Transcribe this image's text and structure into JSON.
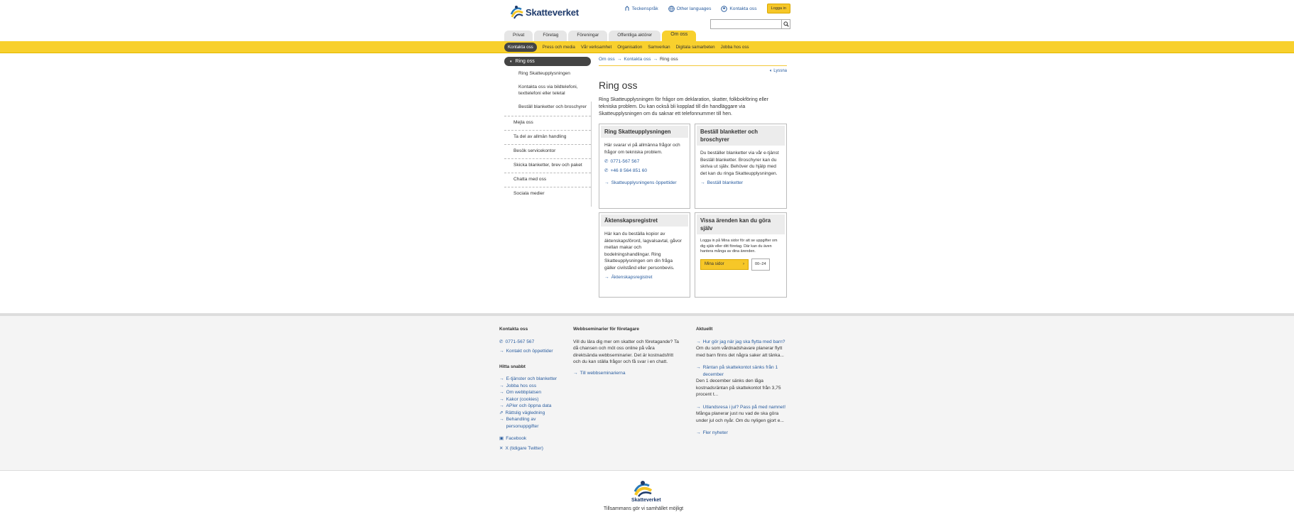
{
  "header": {
    "logo_text": "Skatteverket",
    "top_links": [
      {
        "label": "Teckenspråk",
        "icon": "sign-language-icon"
      },
      {
        "label": "Other languages",
        "icon": "globe-icon"
      },
      {
        "label": "Kontakta oss",
        "icon": "contact-icon"
      }
    ],
    "login_label": "Logga in",
    "search_placeholder": ""
  },
  "tabs": [
    {
      "label": "Privat"
    },
    {
      "label": "Företag"
    },
    {
      "label": "Föreningar"
    },
    {
      "label": "Offentliga aktörer"
    },
    {
      "label": "Om oss"
    }
  ],
  "subnav": [
    {
      "label": "Kontakta oss"
    },
    {
      "label": "Press och media"
    },
    {
      "label": "Vår verksamhet"
    },
    {
      "label": "Organisation"
    },
    {
      "label": "Samverkan"
    },
    {
      "label": "Digitala samarbeten"
    },
    {
      "label": "Jobba hos oss"
    }
  ],
  "leftnav": {
    "current": "Ring oss",
    "subitems": [
      "Ring Skatteupplysningen",
      "Kontakta oss via bildtelefoni, texttelefoni eller teletal",
      "Beställ blanketter och broschyrer"
    ],
    "items": [
      "Mejla oss",
      "Ta del av allmän handling",
      "Besök servicekontor",
      "Skicka blanketter, brev och paket",
      "Chatta med oss",
      "Sociala medier"
    ]
  },
  "main": {
    "breadcrumb": [
      "Om oss",
      "Kontakta oss",
      "Ring oss"
    ],
    "listen_label": "Lyssna",
    "title": "Ring oss",
    "intro": "Ring Skatteupplysningen för frågor om deklaration, skatter, folkbokföring eller tekniska problem. Du kan också bli kopplad till din handläggare via Skatteupplysningen om du saknar ett telefonnummer till hen.",
    "cards": {
      "ring": {
        "title": "Ring Skatteupplysningen",
        "text": "Här svarar vi på allmänna frågor och frågor om tekniska problem.",
        "phone1": "0771-567 567",
        "phone2": "+46 8 564 851 60",
        "link": "Skatteupplysningens öppettider"
      },
      "bestall": {
        "title": "Beställ blanketter och broschyrer",
        "text": "Du beställer blanketter via vår e-tjänst Beställ blanketter. Broschyrer kan du skriva ut själv. Behöver du hjälp med det kan du ringa Skatteupplysningen.",
        "link": "Beställ blanketter"
      },
      "akt": {
        "title": "Äktenskapsregistret",
        "text": "Här kan du beställa kopior av äktenskapsförord, lagvalsavtal, gåvor mellan makar och bodelningshandlingar. Ring Skatteupplysningen om din fråga gäller civilstånd eller personbevis.",
        "link": "Äktenskapsregistret"
      },
      "sjalv": {
        "title": "Vissa ärenden kan du göra själv",
        "text": "Logga in på Mina sidor för att se uppgifter om dig själv eller ditt företag. Där kan du även hantera många av dina ärenden.",
        "button": "Mina sidor",
        "hours": "00–24"
      }
    }
  },
  "footer": {
    "contact": {
      "heading": "Kontakta oss",
      "phone": "0771-567 567",
      "link": "Kontakt och öppettider"
    },
    "quick": {
      "heading": "Hitta snabbt",
      "links": [
        "E-tjänster och blanketter",
        "Jobba hos oss",
        "Om webbplatsen",
        "Kakor (cookies)",
        "APIer och öppna data",
        "Rättslig vägledning",
        "Behandling av personuppgifter"
      ]
    },
    "social": [
      "Facebook",
      "X (tidigare Twitter)"
    ],
    "webinars": {
      "heading": "Webbseminarier för företagare",
      "text": "Vill du lära dig mer om skatter och företagande? Ta då chansen och möt oss online på våra direktsända webbseminarier. Det är kostnadsfritt och du kan ställa frågor och få svar i en chatt.",
      "link": "Till webbseminarierna"
    },
    "news": {
      "heading": "Aktuellt",
      "items": [
        {
          "title": "Hur gör jag när jag ska flytta med barn?",
          "desc": "Om du som vårdnadshavare planerar flytt med barn finns det några saker att tänka..."
        },
        {
          "title": "Räntan på skattekontot sänks från 1 december",
          "desc": "Den 1 december sänks den låga kostnadsräntan på skattekontot från 3,75 procent t..."
        },
        {
          "title": "Utlandsresa i jul? Pass på med namnet!",
          "desc": "Många planerar just nu vad de ska göra under jul och nyår. Om du nyligen gjort e..."
        }
      ],
      "more": "Fler nyheter"
    }
  },
  "bottom": {
    "logo_text": "Skatteverket",
    "slogan": "Tillsammans gör vi samhället möjligt"
  },
  "colors": {
    "yellow": "#f8d02d",
    "link": "#2a5d9f",
    "navy": "#1e3a6b",
    "dark": "#444444"
  }
}
